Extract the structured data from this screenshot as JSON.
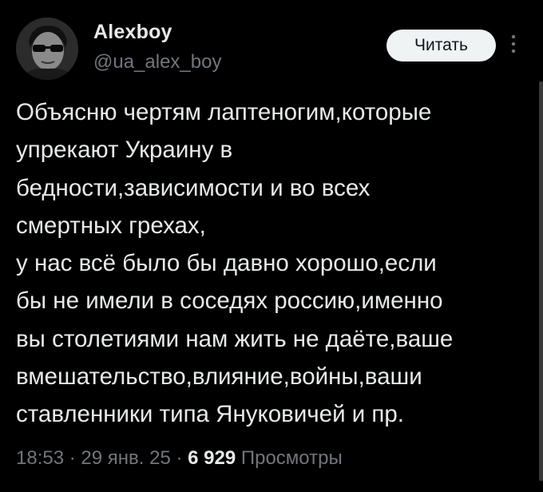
{
  "author": {
    "display_name": "Alexboy",
    "handle": "@ua_alex_boy"
  },
  "actions": {
    "follow_label": "Читать",
    "more_icon": "more-vertical-icon"
  },
  "tweet": {
    "text": "Объясню чертям лаптеногим,которые\nупрекают Украину в\nбедности,зависимости и во всех\nсмертных грехах,\nу нас всё было бы давно хорошо,если\nбы не имели в соседях россию,именно\nвы столетиями нам жить не даёте,ваше\nвмешательство,влияние,войны,ваши\nставленники типа Януковичей и пр."
  },
  "meta": {
    "time": "18:53",
    "separator": " · ",
    "date": "29 янв. 25",
    "views_count": "6 929",
    "views_label": " Просмотры"
  },
  "colors": {
    "background": "#000000",
    "text_primary": "#e7e9ea",
    "text_secondary": "#71767b",
    "button_bg": "#eff3f4"
  }
}
